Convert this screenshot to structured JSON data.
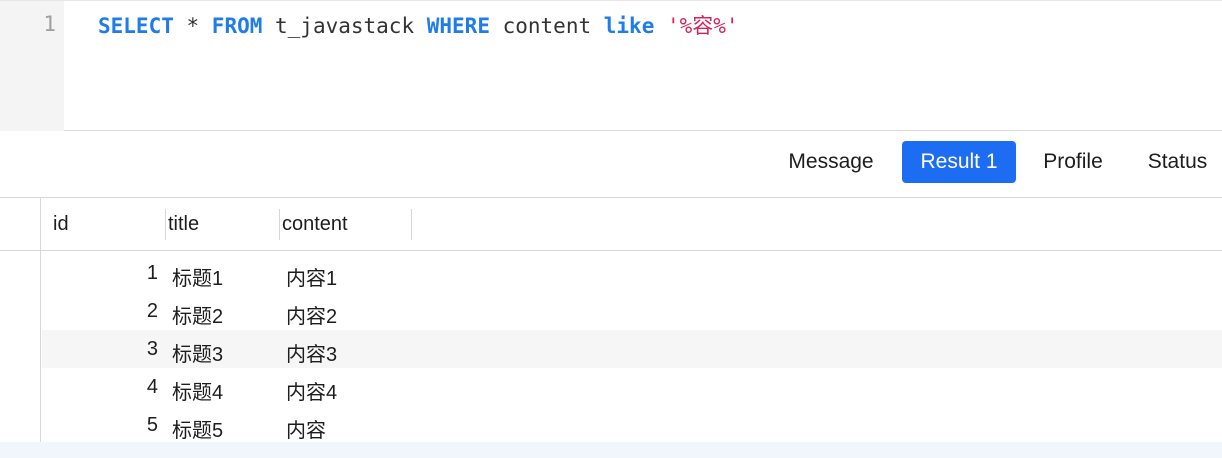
{
  "editor": {
    "line_number": "1",
    "tokens": [
      {
        "text": "SELECT",
        "kind": "kw"
      },
      {
        "text": " * ",
        "kind": "plain"
      },
      {
        "text": "FROM",
        "kind": "kw"
      },
      {
        "text": " t_javastack ",
        "kind": "plain"
      },
      {
        "text": "WHERE",
        "kind": "kw"
      },
      {
        "text": " content ",
        "kind": "plain"
      },
      {
        "text": "like",
        "kind": "kw"
      },
      {
        "text": " ",
        "kind": "plain"
      },
      {
        "text": "'%容%'",
        "kind": "str"
      }
    ]
  },
  "tabs": [
    {
      "label": "Message",
      "active": false
    },
    {
      "label": "Result 1",
      "active": true
    },
    {
      "label": "Profile",
      "active": false
    },
    {
      "label": "Status",
      "active": false
    }
  ],
  "table": {
    "columns": [
      "id",
      "title",
      "content"
    ],
    "rows": [
      {
        "id": "1",
        "title": "标题1",
        "content": "内容1"
      },
      {
        "id": "2",
        "title": "标题2",
        "content": "内容2"
      },
      {
        "id": "3",
        "title": "标题3",
        "content": "内容3"
      },
      {
        "id": "4",
        "title": "标题4",
        "content": "内容4"
      },
      {
        "id": "5",
        "title": "标题5",
        "content": "内容"
      }
    ]
  },
  "colors": {
    "keyword": "#1f7ce8",
    "string": "#d6245c",
    "active_tab": "#1d6df2"
  }
}
